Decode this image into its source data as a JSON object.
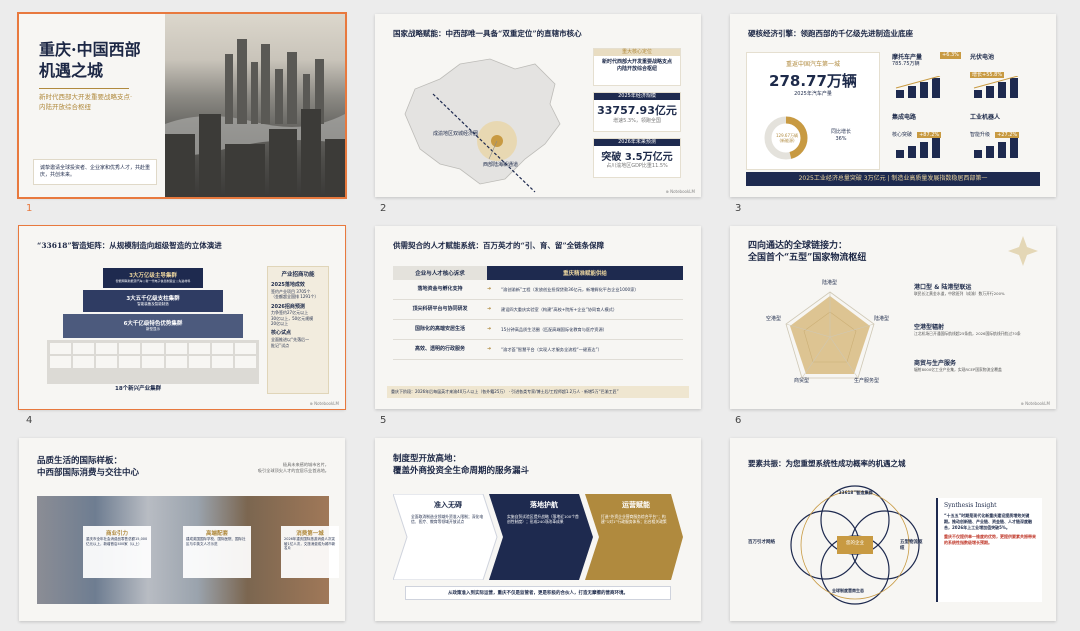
{
  "slides": [
    {
      "num": "1",
      "title": "重庆·中国西部机遇之城",
      "title_l1": "重庆·中国西部",
      "title_l2": "机遇之城",
      "sub_l1": "新时代西部大开发重要战略支点·",
      "sub_l2": "内陆开放综合枢纽",
      "note": "诚挚邀请全球投资者、企业家和优秀人才，共赴重庆，共创未来。"
    },
    {
      "num": "2",
      "title": "国家战略赋能：中西部唯一具备“双重定位”的直辖市核心",
      "map_label1": "成渝地区双城经济圈",
      "map_label2": "西部陆海新通道",
      "stat1_head": "重大核心定位",
      "stat1_body": "新时代西部大开发重要战略支点",
      "stat1_body2": "内陆开放综合枢纽",
      "stat2_head": "2025年经济规模",
      "stat2_value": "33757.93亿元",
      "stat2_note": "增速5.3%，领跑全国",
      "stat3_head": "2026年未来预测",
      "stat3_value": "突破 3.5万亿元",
      "stat3_note": "占川渝地区GDP比重11.5%"
    },
    {
      "num": "3",
      "title": "硬核经济引擎：领跑西部的千亿级先进制造业底座",
      "card_head": "重返中国汽车第一城",
      "card_value": "278.77万辆",
      "card_sub": "2025年汽车产量",
      "donut_label": "129.67万辆",
      "donut_label2": "(新能源)",
      "growth_label": "同比增长",
      "growth_value": "36%",
      "m1_title": "摩托车产量",
      "m1_sub": "785.75万辆",
      "m1_badge": "+6.3%",
      "m2_title": "光伏电池",
      "m2_badge": "增长+55.8%",
      "m3_title": "集成电路",
      "m3_sub": "核心突破",
      "m3_badge": "+87.2%",
      "m4_title": "工业机器人",
      "m4_sub": "智能升级",
      "m4_badge": "+27.2%",
      "footer": "2025工业经济总量突破 3万亿元 | 制造业高质量发展指数稳居西部第一"
    },
    {
      "num": "4",
      "title": "“33618”智造矩阵：从规模制造向超级智造的立体演进",
      "tier1": "3大万亿级主导集群",
      "tier1_sub": "智能网联新能源汽车 | 新一代电子信息制造业 | 先进材料",
      "tier2": "3大五千亿级支柱集群",
      "tier2_sub": "智能装备及智能制造",
      "tier3": "6大千亿级特色优势集群",
      "tier3_sub": "新型显示",
      "tier4": "18个新兴产业集群",
      "side_head": "产业招商功能",
      "side1_title": "2025落地成效",
      "side1_body": "签约产业项目 3705个",
      "side1_body2": "（金额超全国排 1291个）",
      "side2_title": "2026招商预测",
      "side2_body": "力争签约27亿元以上",
      "side2_body2": "30亿以上，50亿元规模",
      "side2_body3": "20亿以上",
      "side3_title": "核心试点",
      "side3_body": "全面推进以“先落后一",
      "side3_body2": "批记”试点"
    },
    {
      "num": "5",
      "title": "供需契合的人才赋能系统：百万英才的“引、育、留”全链条保障",
      "col1": "企业与人才核心诉求",
      "col2": "重庆精准赋能供给",
      "rows": [
        {
          "need": "落地资金与孵化支持",
          "supply": "“渝创渝新”工程（发放创业担保贷款36亿元，新增孵化平台企业1000家）"
        },
        {
          "need": "顶尖科研平台与协同研发",
          "supply": "建设四大重庆实验室（构建“高校+院所+企业”协同育人模式）"
        },
        {
          "need": "国际化的高端安居生活",
          "supply": "15分钟高品质生活圈（匹配高端国际化教育与医疗资源）"
        },
        {
          "need": "高效、透明的行政服务",
          "supply": "“渝才荟”智慧平台（实现人才服务全流程“一键直达”）"
        }
      ],
      "footer": "重庆下阶段：2026年后每届英才来渝40万人以上（各外籍25万）  ·  引进各类专家/博士后/工程师超1.2万人  ·  新增5万“巴渝工匠”"
    },
    {
      "num": "6",
      "title_l1": "四向通达的全球链接力：",
      "title_l2": "全国首个“五型”国家物流枢纽",
      "radar_axes": [
        "陆港型",
        "陆港型",
        "生产服务型",
        "商贸型",
        "空港型"
      ],
      "item1_title": "港口型 & 陆港型联运",
      "item1_body": "联民长江黄金水道，中欧班列（成渝）数万开行200%",
      "item2_title": "空港型辐射",
      "item2_body": "江北机场已开通国际航线超25条航，2026国际航线开航过70条",
      "item3_title": "商贸与生产服务",
      "item3_body": "辐射8000亿工业产业集，实现RCEP国家物流全覆盖"
    },
    {
      "num": "7",
      "title_l1": "品质生活的国际样板：",
      "title_l2": "中西部国际消费与交往中心",
      "side_note": "极具未来感的城市名片，",
      "side_note2": "吸引全球顶尖人才的宜居乐业首选地。",
      "card1_title": "商业引力",
      "card1_body": "重庆市全年社会消费品零售总额15,000亿元以上，新增首店400家（以上）",
      "card2_title": "高端配套",
      "card2_body": "建成英国国际学校、国际医院、国际社区与中英文人才示范",
      "card3_title": "消费第一城",
      "card3_body": "2026年重庆国际旅游消费人次突破1亿人次，文旅消费成为城市新名片"
    },
    {
      "num": "8",
      "title_l1": "制度型开放高地：",
      "title_l2": "覆盖外商投资全生命周期的服务漏斗",
      "step1": "准入无碍",
      "step1_body": "全面取消制造业领域外资准入限制；深化电信、医疗、教育等领域开放试点",
      "step2": "落地护航",
      "step2_body": "实施自贸试验区提升战略（落地近100个首创性制度）；形成240项改革成果",
      "step3": "运营赋能",
      "step3_body": "打造“外资企业营商服务综合平台”；构建“1对1”行政服务体系；出台相关政策",
      "footer": "从政策准入到实际运营，重庆不仅是监管者，更是积极的合伙人，打造无摩擦的营商环境。"
    },
    {
      "num": "9",
      "title": "要素共振：为您重塑系统性成功概率的机遇之城",
      "venn_top": "“33618”智造集群",
      "venn_left": "百万引才网络",
      "venn_right": "五型物流枢纽",
      "venn_bottom": "全球制度营商生态",
      "venn_center": "您的企业",
      "insight_head": "Synthesis Insight",
      "insight_body": "“十五五”时期是现代化新重庆建设提质增效关键期。推动创新链、产业链、资金链、人才链深度融合，2026年上工业增加值突破5%。",
      "insight_foot": "重庆不仅提供单一维度的优势，更提供要素共振带来的系统性指数级增长预期。"
    }
  ],
  "watermark": "⊕ NotebookLM",
  "colors": {
    "navy": "#1e2a4f",
    "gold": "#b08a3e",
    "accent": "#e8793e",
    "bg": "#f7f6f3"
  }
}
